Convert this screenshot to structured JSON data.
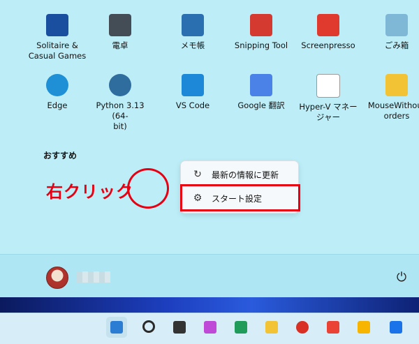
{
  "apps": [
    {
      "label": "Solitaire &\nCasual Games",
      "icon": "cards-icon",
      "color": "#1a4fa0"
    },
    {
      "label": "電卓",
      "icon": "calculator-icon",
      "color": "#444c56"
    },
    {
      "label": "メモ帳",
      "icon": "notepad-icon",
      "color": "#2a6fb0"
    },
    {
      "label": "Snipping Tool",
      "icon": "scissors-icon",
      "color": "#d43a2f"
    },
    {
      "label": "Screenpresso",
      "icon": "screenpresso-icon",
      "color": "#e03a2e"
    },
    {
      "label": "ごみ箱",
      "icon": "recycle-bin-icon",
      "color": "#7fb7d6"
    },
    {
      "label": "Edge",
      "icon": "edge-icon",
      "color": "#1f8fd6"
    },
    {
      "label": "Python 3.13 (64-\nbit)",
      "icon": "python-icon",
      "color": "#2f6d9e"
    },
    {
      "label": "VS Code",
      "icon": "vscode-icon",
      "color": "#1e88d8"
    },
    {
      "label": "Google 翻訳",
      "icon": "google-translate-icon",
      "color": "#4a82e8"
    },
    {
      "label": "Hyper-V マネー\nジャー",
      "icon": "document-icon",
      "color": "#ffffff"
    },
    {
      "label": "MouseWithout\norders",
      "icon": "folder-icon",
      "color": "#f2c335"
    }
  ],
  "section": {
    "recommended": "おすすめ"
  },
  "context_menu": {
    "refresh": {
      "label": "最新の情報に更新",
      "icon": "refresh-icon"
    },
    "settings": {
      "label": "スタート設定",
      "icon": "gear-icon"
    }
  },
  "annotation": {
    "text": "右クリック",
    "color": "#e60012"
  },
  "bottom": {
    "power_icon": "power-icon"
  },
  "taskbar": [
    {
      "icon": "windows-start-icon",
      "color": "#2b7cd3"
    },
    {
      "icon": "search-icon",
      "color": "#2a2a2a"
    },
    {
      "icon": "task-view-icon",
      "color": "#333"
    },
    {
      "icon": "copilot-icon",
      "color": "#c04ad8"
    },
    {
      "icon": "widgets-icon",
      "color": "#1f9b5a"
    },
    {
      "icon": "file-explorer-icon",
      "color": "#f2c335"
    },
    {
      "icon": "chrome-icon",
      "color": "#d93025"
    },
    {
      "icon": "gmail-icon",
      "color": "#ea4335"
    },
    {
      "icon": "keep-icon",
      "color": "#f7b500"
    },
    {
      "icon": "calendar-icon",
      "color": "#1a73e8"
    }
  ]
}
